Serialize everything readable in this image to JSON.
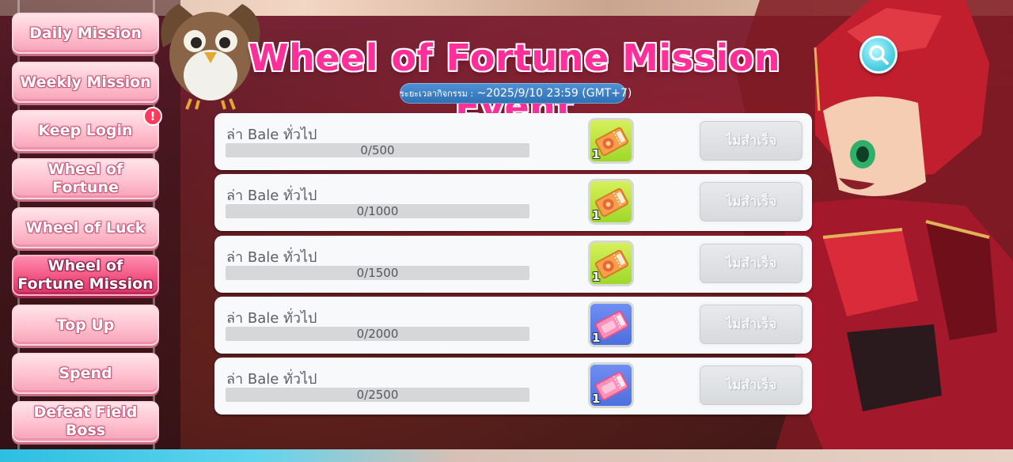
{
  "event": {
    "title": "Wheel of Fortune Mission Event",
    "period": "ระยะเวลากิจกรรม : ~2025/9/10 23:59 (GMT+7)",
    "period_label": "ระยะเวลากิจกรรม :",
    "period_value": "~2025/9/10 23:59 (GMT+7)"
  },
  "sidebar": {
    "items": [
      {
        "label": "Daily Mission"
      },
      {
        "label": "Weekly Mission"
      },
      {
        "label": "Keep Login",
        "badge": "!"
      },
      {
        "label": "Wheel of Fortune"
      },
      {
        "label": "Wheel of Luck"
      },
      {
        "label": "Wheel of Fortune Mission",
        "active": true
      },
      {
        "label": "Top Up"
      },
      {
        "label": "Spend"
      },
      {
        "label": "Defeat Field Boss"
      }
    ]
  },
  "missions": [
    {
      "name": "ล่า Bale ทั่วไป",
      "progress": "0/500",
      "current": 0,
      "target": 500,
      "reward_icon": "fortune-ticket-icon",
      "reward_color": "green",
      "reward_qty": "1",
      "status": "ไม่สำเร็จ"
    },
    {
      "name": "ล่า Bale ทั่วไป",
      "progress": "0/1000",
      "current": 0,
      "target": 1000,
      "reward_icon": "fortune-ticket-icon",
      "reward_color": "green",
      "reward_qty": "1",
      "status": "ไม่สำเร็จ"
    },
    {
      "name": "ล่า Bale ทั่วไป",
      "progress": "0/1500",
      "current": 0,
      "target": 1500,
      "reward_icon": "fortune-ticket-icon",
      "reward_color": "green",
      "reward_qty": "1",
      "status": "ไม่สำเร็จ"
    },
    {
      "name": "ล่า Bale ทั่วไป",
      "progress": "0/2000",
      "current": 0,
      "target": 2000,
      "reward_icon": "luck-ticket-icon",
      "reward_color": "blue",
      "reward_qty": "1",
      "status": "ไม่สำเร็จ"
    },
    {
      "name": "ล่า Bale ทั่วไป",
      "progress": "0/2500",
      "current": 0,
      "target": 2500,
      "reward_icon": "luck-ticket-icon",
      "reward_color": "blue",
      "reward_qty": "1",
      "status": "ไม่สำเร็จ"
    }
  ],
  "colors": {
    "title": "#ff2f9a",
    "menu_active": "#f0507e",
    "menu_inactive": "#ffc1cf",
    "period_bg": "#2e6fb4",
    "search": "#3fcadf"
  }
}
